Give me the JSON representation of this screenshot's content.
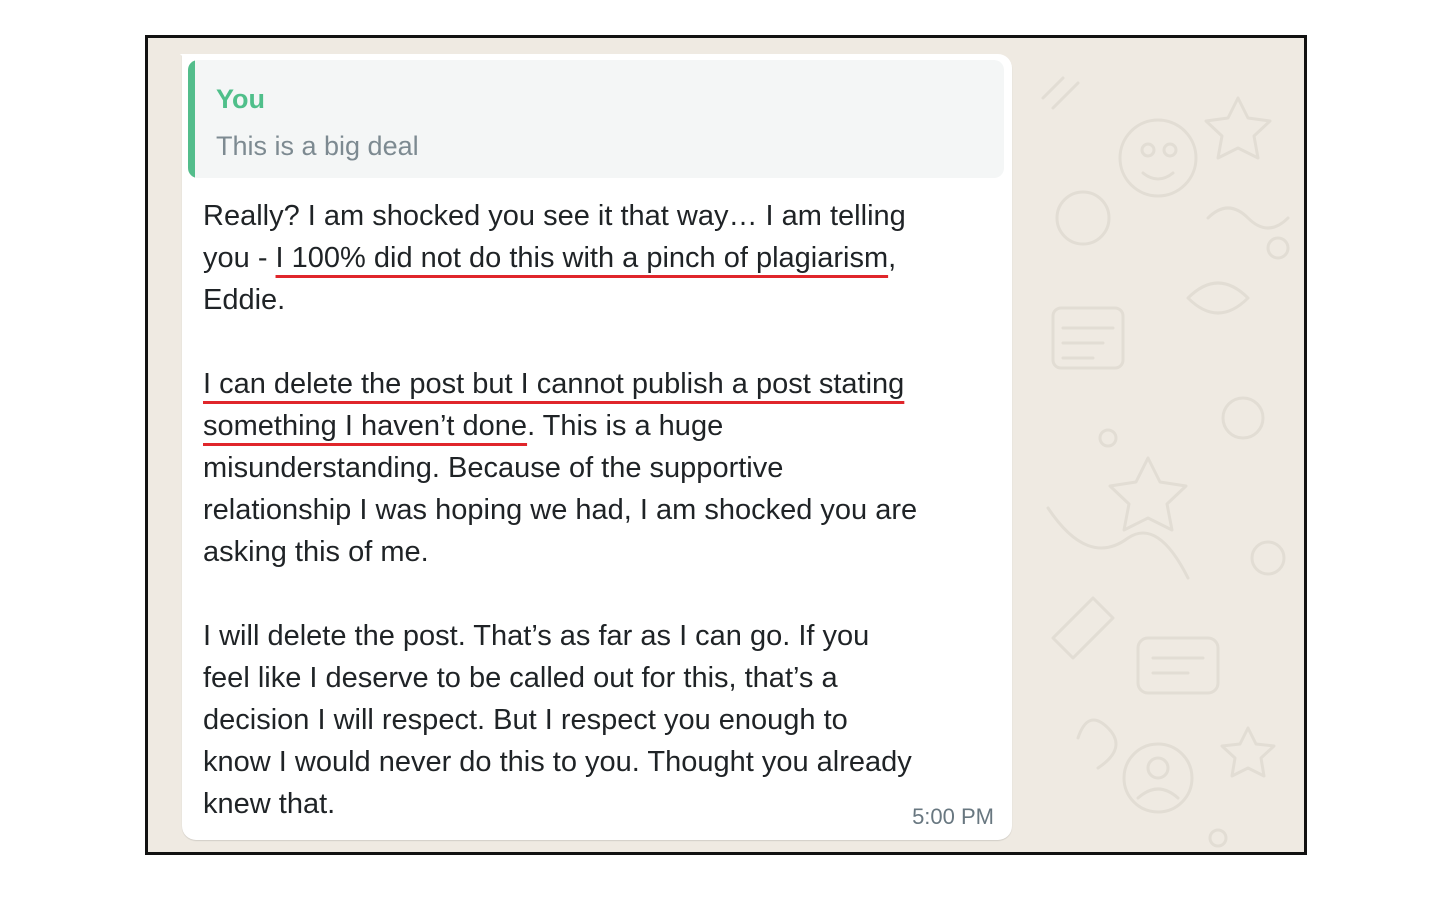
{
  "message": {
    "quoted": {
      "author": "You",
      "text": "This is a big deal"
    },
    "paragraphs": [
      {
        "lines": [
          [
            {
              "text": "Really? I am shocked you see it that way… I am telling",
              "u": false
            }
          ],
          [
            {
              "text": "you - ",
              "u": false
            },
            {
              "text": "I 100% did not do this with a pinch of plagiarism",
              "u": true
            },
            {
              "text": ",",
              "u": false
            }
          ],
          [
            {
              "text": "Eddie.",
              "u": false
            }
          ]
        ]
      },
      {
        "lines": [
          [
            {
              "text": "I can delete the post but I cannot publish a post stating",
              "u": true
            }
          ],
          [
            {
              "text": "something I haven’t done",
              "u": true
            },
            {
              "text": ". This is a huge",
              "u": false
            }
          ],
          [
            {
              "text": "misunderstanding. Because of the supportive",
              "u": false
            }
          ],
          [
            {
              "text": "relationship I was hoping we had, I am shocked you are",
              "u": false
            }
          ],
          [
            {
              "text": "asking this of me.",
              "u": false
            }
          ]
        ]
      },
      {
        "lines": [
          [
            {
              "text": "I will delete the post. That’s as far as I can go. If you",
              "u": false
            }
          ],
          [
            {
              "text": "feel like I deserve to be called out for this, that’s a",
              "u": false
            }
          ],
          [
            {
              "text": "decision I will respect. But I respect you enough to",
              "u": false
            }
          ],
          [
            {
              "text": "know I would never do this to you. Thought you already",
              "u": false
            }
          ],
          [
            {
              "text": "knew that.",
              "u": false
            }
          ]
        ]
      }
    ],
    "time": "5:00 PM"
  },
  "colors": {
    "chat_background": "#efeae2",
    "bubble": "#ffffff",
    "quote_accent": "#53bd8b",
    "underline": "#e0262b"
  }
}
